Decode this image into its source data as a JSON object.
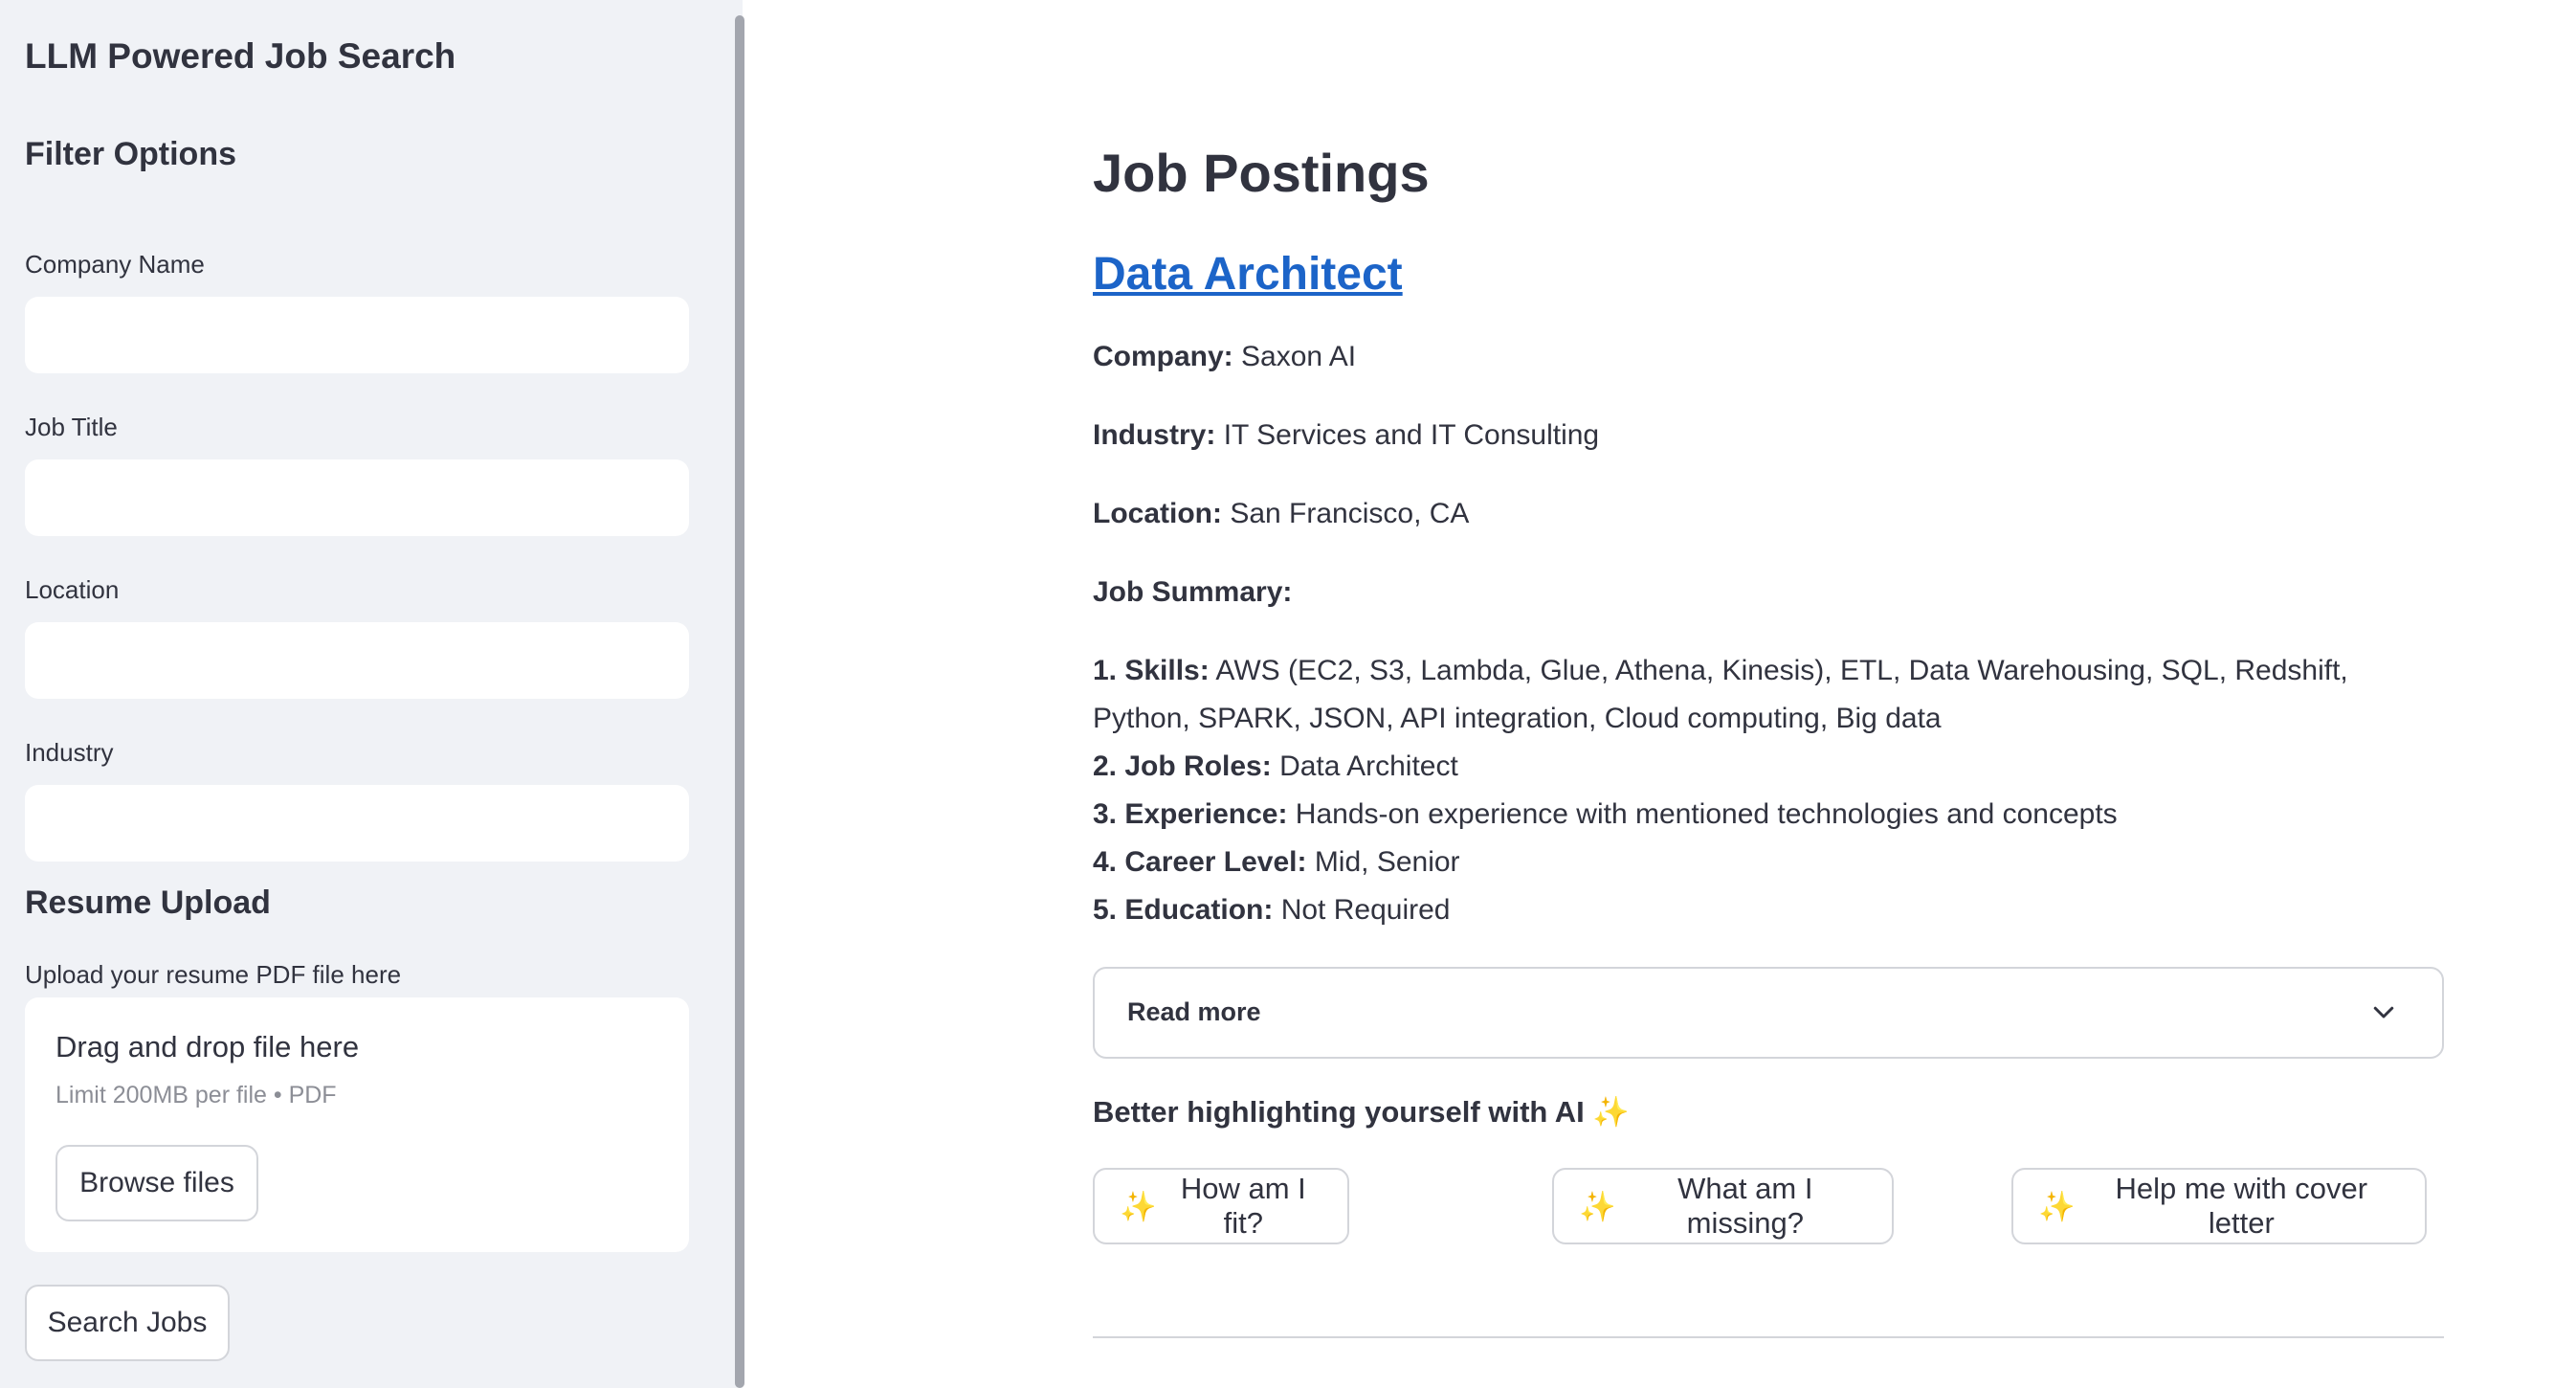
{
  "sidebar": {
    "app_title": "LLM Powered Job Search",
    "filter_heading": "Filter Options",
    "fields": {
      "company_label": "Company Name",
      "company_value": "",
      "job_title_label": "Job Title",
      "job_title_value": "",
      "location_label": "Location",
      "location_value": "",
      "industry_label": "Industry",
      "industry_value": ""
    },
    "resume_heading": "Resume Upload",
    "upload_label": "Upload your resume PDF file here",
    "dropzone_title": "Drag and drop file here",
    "dropzone_limit": "Limit 200MB per file • PDF",
    "browse_label": "Browse files",
    "search_label": "Search Jobs"
  },
  "main": {
    "title": "Job Postings",
    "job": {
      "title": "Data Architect",
      "company_label": "Company:",
      "company": "Saxon AI",
      "industry_label": "Industry:",
      "industry": "IT Services and IT Consulting",
      "location_label": "Location:",
      "location": "San Francisco, CA",
      "summary_label": "Job Summary:",
      "summary": [
        {
          "label": "1. Skills:",
          "value": "AWS (EC2, S3, Lambda, Glue, Athena, Kinesis), ETL, Data Warehousing, SQL, Redshift, Python, SPARK, JSON, API integration, Cloud computing, Big data"
        },
        {
          "label": "2. Job Roles:",
          "value": "Data Architect"
        },
        {
          "label": "3. Experience:",
          "value": "Hands-on experience with mentioned technologies and concepts"
        },
        {
          "label": "4. Career Level:",
          "value": "Mid, Senior"
        },
        {
          "label": "5. Education:",
          "value": "Not Required"
        }
      ],
      "read_more": "Read more"
    },
    "ai": {
      "heading": "Better highlighting yourself with AI",
      "heading_icon": "✨",
      "button_icon": "✨",
      "fit_label": "How am I fit?",
      "missing_label": "What am I missing?",
      "cover_letter_label": "Help me with cover letter"
    }
  },
  "colors": {
    "sidebar_bg": "#f0f2f6",
    "text": "#31333f",
    "link": "#1c64c8",
    "border": "#d3d5da",
    "sparkle": "#f0c020"
  }
}
